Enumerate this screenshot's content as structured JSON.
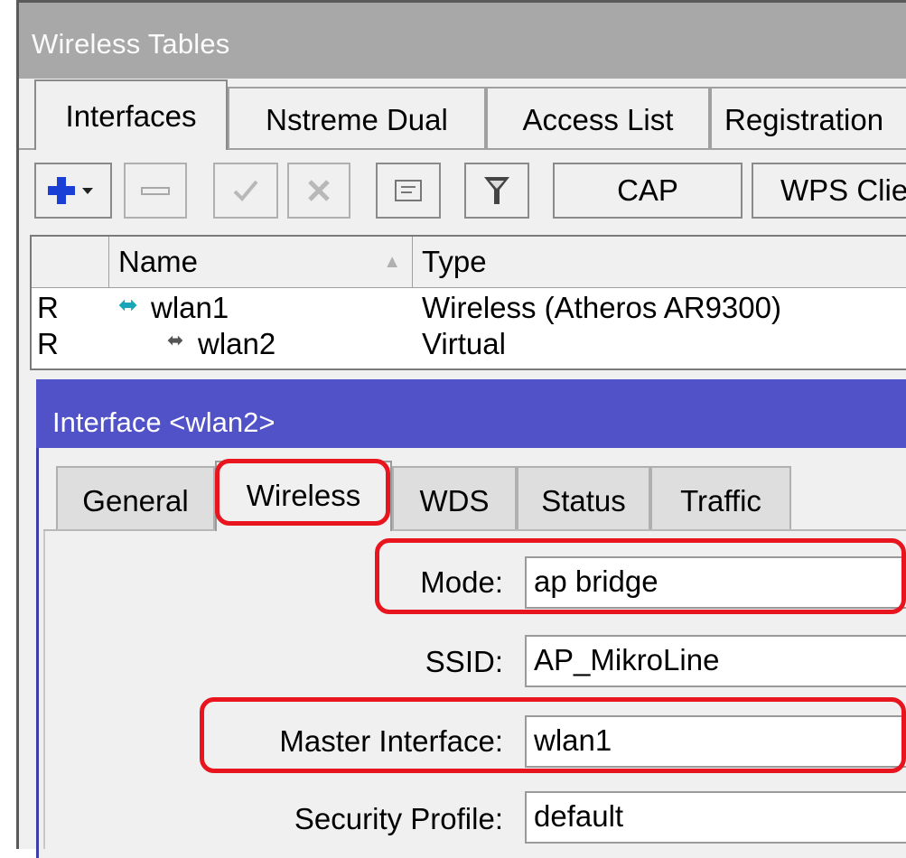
{
  "window": {
    "title": "Wireless Tables"
  },
  "tabs": [
    {
      "label": "Interfaces",
      "active": true
    },
    {
      "label": "Nstreme Dual"
    },
    {
      "label": "Access List"
    },
    {
      "label": "Registration"
    }
  ],
  "toolbar": {
    "add_icon": "plus-dropdown-icon",
    "remove_icon": "minus-icon",
    "enable_icon": "check-icon",
    "disable_icon": "x-icon",
    "comment_icon": "comment-icon",
    "filter_icon": "filter-icon",
    "cap_label": "CAP",
    "wps_label": "WPS Client"
  },
  "list": {
    "columns": {
      "name": "Name",
      "type": "Type"
    },
    "rows": [
      {
        "flag": "R",
        "name": "wlan1",
        "type": "Wireless (Atheros AR9300)"
      },
      {
        "flag": "R",
        "name": "wlan2",
        "type": "Virtual"
      }
    ]
  },
  "dialog": {
    "title": "Interface <wlan2>",
    "tabs": [
      "General",
      "Wireless",
      "WDS",
      "Status",
      "Traffic"
    ],
    "active_tab": "Wireless",
    "fields": {
      "mode": {
        "label": "Mode:",
        "value": "ap bridge"
      },
      "ssid": {
        "label": "SSID:",
        "value": "AP_MikroLine"
      },
      "master_interface": {
        "label": "Master Interface:",
        "value": "wlan1"
      },
      "security_profile": {
        "label": "Security Profile:",
        "value": "default"
      }
    }
  },
  "colors": {
    "window_title_bg": "#a8a8a8",
    "dialog_title_bg": "#5252c8",
    "highlight": "#e8141e",
    "add_icon": "#1a3fd6",
    "wireless_icon": "#17a6b8"
  }
}
